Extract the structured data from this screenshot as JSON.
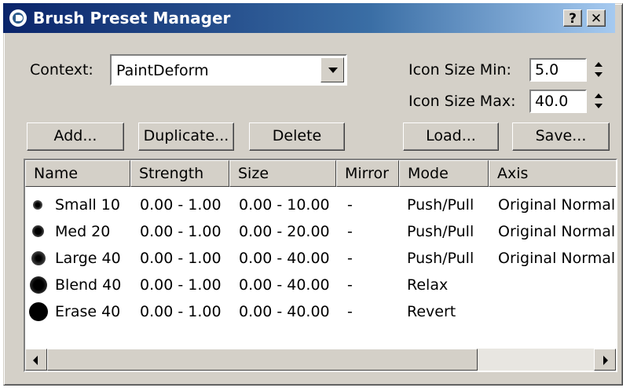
{
  "window": {
    "title": "Brush Preset Manager",
    "help_label": "?",
    "close_label": "✕"
  },
  "context": {
    "label": "Context:",
    "value": "PaintDeform"
  },
  "icon_size": {
    "min_label": "Icon Size Min:",
    "min_value": "5.0",
    "max_label": "Icon Size Max:",
    "max_value": "40.0"
  },
  "buttons": {
    "add": "Add...",
    "duplicate": "Duplicate...",
    "delete": "Delete",
    "load": "Load...",
    "save": "Save..."
  },
  "table": {
    "columns": [
      "Name",
      "Strength",
      "Size",
      "Mirror",
      "Mode",
      "Axis"
    ],
    "rows": [
      {
        "name": "Small 10",
        "strength": "0.00 - 1.00",
        "size": "0.00 - 10.00",
        "mirror": "-",
        "mode": "Push/Pull",
        "axis": "Original Normal:",
        "dot_size": 10
      },
      {
        "name": "Med 20",
        "strength": "0.00 - 1.00",
        "size": "0.00 - 20.00",
        "mirror": "-",
        "mode": "Push/Pull",
        "axis": "Original Normal:",
        "dot_size": 20
      },
      {
        "name": "Large 40",
        "strength": "0.00 - 1.00",
        "size": "0.00 - 40.00",
        "mirror": "-",
        "mode": "Push/Pull",
        "axis": "Original Normal:",
        "dot_size": 40
      },
      {
        "name": "Blend 40",
        "strength": "0.00 - 1.00",
        "size": "0.00 - 40.00",
        "mirror": "-",
        "mode": "Relax",
        "axis": "",
        "dot_size": 40
      },
      {
        "name": "Erase 40",
        "strength": "0.00 - 1.00",
        "size": "0.00 - 40.00",
        "mirror": "-",
        "mode": "Revert",
        "axis": "",
        "dot_size": 40
      }
    ]
  },
  "colors": {
    "titlebar_start": "#0a246a",
    "titlebar_end": "#a6caf0",
    "face": "#d4d0c8"
  }
}
